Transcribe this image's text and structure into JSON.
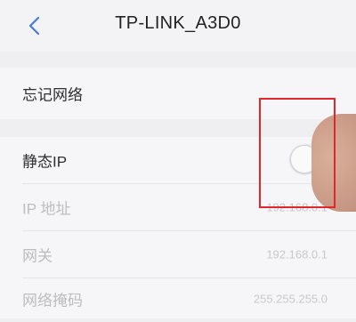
{
  "header": {
    "title": "TP-LINK_A3D0",
    "back_icon": "chevron-left-icon"
  },
  "forget_network": {
    "label": "忘记网络"
  },
  "static_ip": {
    "label": "静态IP",
    "enabled": false
  },
  "ip_address": {
    "label": "IP 地址",
    "value": "192.168.0.1"
  },
  "gateway": {
    "label": "网关",
    "value": "192.168.0.1"
  },
  "subnet_mask": {
    "label": "网络掩码",
    "value": "255.255.255.0"
  },
  "colors": {
    "accent": "#4a7bd6",
    "highlight": "#e0272b",
    "background": "#efeff1"
  }
}
